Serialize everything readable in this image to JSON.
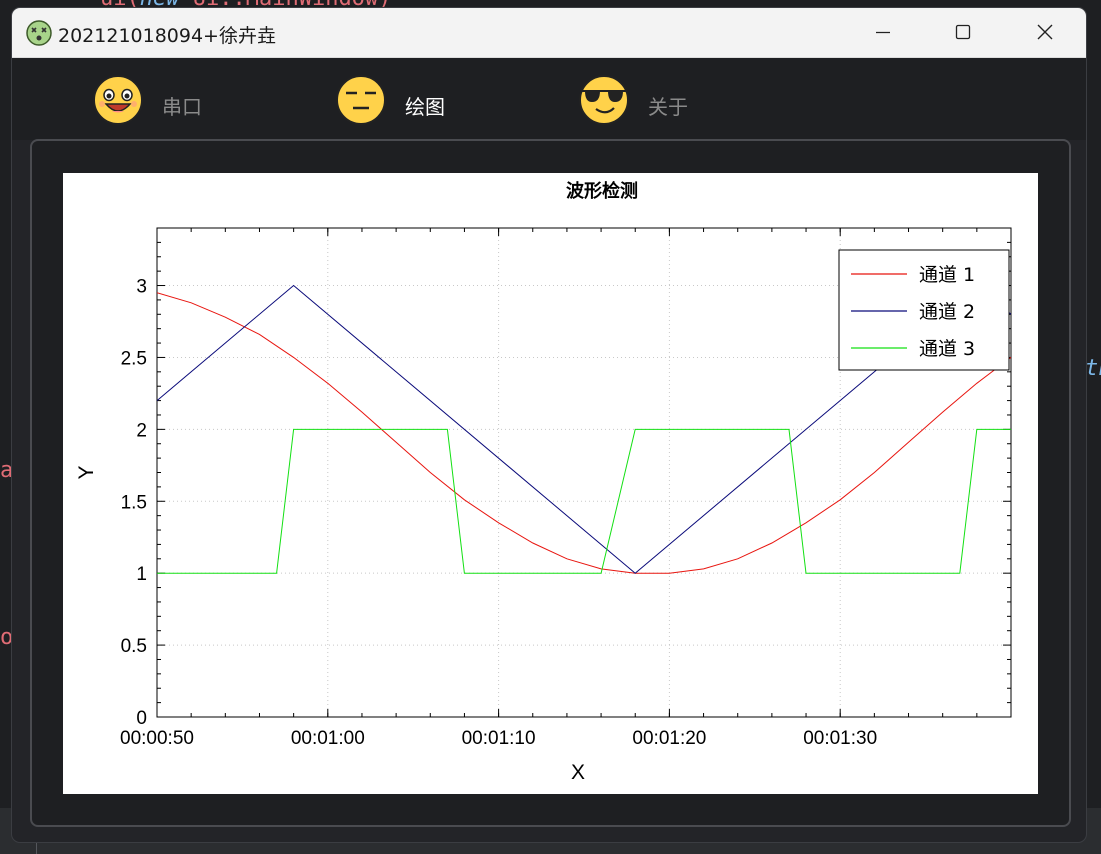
{
  "window": {
    "title": "202121018094+徐卉垚"
  },
  "tabs": [
    {
      "label": "串口",
      "icon": "grinning-face-icon",
      "active": false
    },
    {
      "label": "绘图",
      "icon": "expressionless-face-icon",
      "active": true
    },
    {
      "label": "关于",
      "icon": "sunglasses-face-icon",
      "active": false
    }
  ],
  "colors": {
    "accent": "#1fb784",
    "channel1": "#e8150f",
    "channel2": "#0a0a7a",
    "channel3": "#13e013"
  },
  "chart_data": {
    "type": "line",
    "title": "波形检测",
    "xlabel": "X",
    "ylabel": "Y",
    "x_axis_type": "time",
    "xlim": [
      "00:00:50",
      "00:01:40"
    ],
    "ylim": [
      0,
      3.4
    ],
    "x_ticks": [
      "00:00:50",
      "00:01:00",
      "00:01:10",
      "00:01:20",
      "00:01:30"
    ],
    "y_ticks": [
      "0",
      "0.5",
      "1",
      "1.5",
      "2",
      "2.5",
      "3"
    ],
    "grid": true,
    "legend_position": "top-right",
    "series": [
      {
        "name": "通道 1",
        "color": "#e8150f",
        "x": [
          "00:00:50",
          "00:00:52",
          "00:00:54",
          "00:00:56",
          "00:00:58",
          "00:01:00",
          "00:01:02",
          "00:01:04",
          "00:01:06",
          "00:01:08",
          "00:01:10",
          "00:01:12",
          "00:01:14",
          "00:01:16",
          "00:01:18",
          "00:01:20",
          "00:01:22",
          "00:01:24",
          "00:01:26",
          "00:01:28",
          "00:01:30",
          "00:01:32",
          "00:01:34",
          "00:01:36",
          "00:01:38",
          "00:01:40"
        ],
        "y": [
          2.95,
          2.88,
          2.78,
          2.66,
          2.5,
          2.32,
          2.12,
          1.91,
          1.7,
          1.51,
          1.35,
          1.21,
          1.1,
          1.03,
          1.0,
          1.0,
          1.03,
          1.1,
          1.21,
          1.35,
          1.51,
          1.7,
          1.91,
          2.12,
          2.32,
          2.5
        ]
      },
      {
        "name": "通道 2",
        "color": "#0a0a7a",
        "x": [
          "00:00:50",
          "00:00:58",
          "00:01:18",
          "00:01:38",
          "00:01:40"
        ],
        "y": [
          2.2,
          3.0,
          1.0,
          3.0,
          2.8
        ]
      },
      {
        "name": "通道 3",
        "color": "#13e013",
        "x": [
          "00:00:50",
          "00:00:57",
          "00:00:58",
          "00:01:07",
          "00:01:08",
          "00:01:16",
          "00:01:18",
          "00:01:27",
          "00:01:28",
          "00:01:37",
          "00:01:38",
          "00:01:40"
        ],
        "y": [
          1,
          1,
          2,
          2,
          1,
          1,
          2,
          2,
          1,
          1,
          2,
          2
        ]
      }
    ]
  }
}
